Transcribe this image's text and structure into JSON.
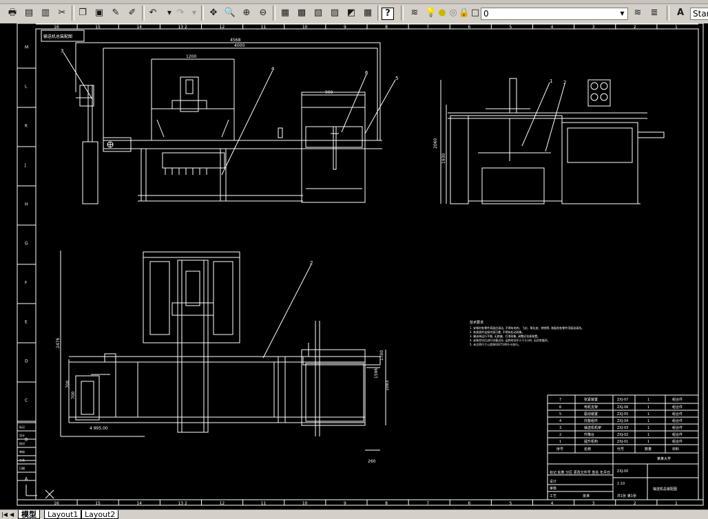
{
  "toolbar": {
    "layer_name": "0",
    "text_style": "Standard",
    "icons": [
      "print-preview-icon",
      "plot-icon",
      "publish-icon",
      "cut-icon",
      "copy-icon",
      "paste-icon",
      "match-properties-icon",
      "undo-icon",
      "redo-icon",
      "pan-icon",
      "zoom-realtime-icon",
      "zoom-window-icon",
      "zoom-previous-icon",
      "properties-icon",
      "design-center-icon",
      "tool-palettes-icon",
      "sheet-set-icon",
      "markup-icon",
      "calculator-icon",
      "help-icon",
      "layer-manager-icon",
      "layer-bulb-icon",
      "layer-sun-icon",
      "layer-lock-icon",
      "layer-color-icon",
      "make-current-icon",
      "layer-previous-icon",
      "text-style-icon"
    ]
  },
  "drawing": {
    "colors": {
      "background": "#000000",
      "lines": "#ffffff"
    },
    "top_ruler": [
      "16",
      "15",
      "14",
      "13 2",
      "12",
      "11",
      "10",
      "9",
      "8",
      "7",
      "6",
      "5",
      "4",
      "3",
      "2",
      "1"
    ],
    "left_ruler": [
      "M",
      "L",
      "K",
      "J",
      "H",
      "G",
      "F",
      "E",
      "D",
      "C",
      "B",
      "A"
    ],
    "title_tag": "输送机总装配图",
    "dims": {
      "front_overall": "4568",
      "front_total": "4000",
      "front_top": "1200",
      "front_right": "900",
      "side_height": "2060",
      "side_height2": "1930",
      "plan_height": "2476",
      "plan_left": "700",
      "plan_left_w": "700",
      "plan_right_h": "1083",
      "plan_right_w": "1700",
      "plan_bottom": "260",
      "plan_small": "1596",
      "plan_bottom_left": "4 995.00"
    },
    "balloons": [
      "3",
      "4",
      "6",
      "5",
      "1",
      "2",
      "2"
    ],
    "notes_title": "技术要求",
    "notes": [
      "1. 安装时各零件表面应清洁, 不得有毛刺、飞边、氧化皮、锈蚀等, 装配前各零件用煤油清洗。",
      "2. 各紧固件连接牢固可靠, 不得有松动现象。",
      "3. 输送带运行平稳, 无跑偏、打滑现象, 调整好张紧装置。",
      "4. 安装完毕后进行空载试车, 运转时间不少于2小时, 无异常噪声。",
      "5. 未注明尺寸公差按GB/T1804-m执行。"
    ],
    "bom": [
      {
        "no": "7",
        "name": "张紧装置",
        "code": "ZXJ-07",
        "qty": "1",
        "material": "组合件"
      },
      {
        "no": "6",
        "name": "电机支架",
        "code": "ZXJ-06",
        "qty": "1",
        "material": "组合件"
      },
      {
        "no": "5",
        "name": "驱动装置",
        "code": "ZXJ-05",
        "qty": "1",
        "material": "组合件"
      },
      {
        "no": "4",
        "name": "托辊组件",
        "code": "ZXJ-04",
        "qty": "1",
        "material": "组合件"
      },
      {
        "no": "3",
        "name": "输送机机架",
        "code": "ZXJ-03",
        "qty": "1",
        "material": "组合件"
      },
      {
        "no": "2",
        "name": "升降台",
        "code": "ZXJ-02",
        "qty": "1",
        "material": "组合件"
      },
      {
        "no": "1",
        "name": "提升机构",
        "code": "ZXJ-01",
        "qty": "1",
        "material": "组合件"
      }
    ],
    "bom_header": [
      "序号",
      "名称",
      "代号",
      "数量",
      "材料"
    ],
    "title_block": {
      "school": "某某大学",
      "drawing_name": "输送机总装配图",
      "drawing_no": "ZXJ-00",
      "scale": "1:10",
      "sheet": "共1张 第1张",
      "rows": [
        "标记 处数 分区 更改文件号 签名 年月日",
        "设计",
        "审核",
        "工艺",
        "批准"
      ]
    },
    "revision_labels": [
      "标记",
      "设计",
      "校对",
      "审核",
      "工艺",
      "日期"
    ]
  },
  "tabs": [
    "模型",
    "Layout1",
    "Layout2"
  ]
}
